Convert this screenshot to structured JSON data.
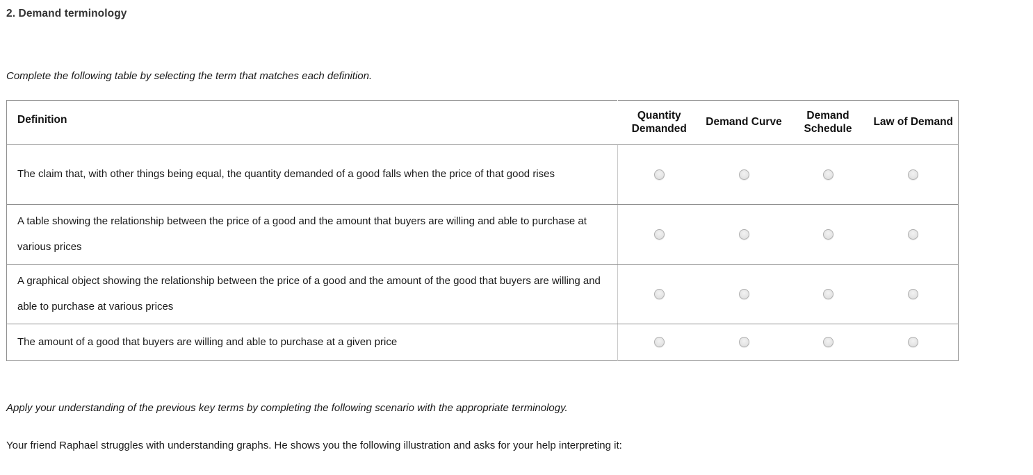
{
  "question": {
    "title": "2. Demand terminology",
    "instruction_table": "Complete the following table by selecting the term that matches each definition.",
    "instruction_scenario": "Apply your understanding of the previous key terms by completing the following scenario with the appropriate terminology.",
    "scenario_intro": "Your friend Raphael struggles with understanding graphs. He shows you the following illustration and asks for your help interpreting it:"
  },
  "table": {
    "headers": {
      "definition": "Definition",
      "options": [
        "Quantity Demanded",
        "Demand Curve",
        "Demand Schedule",
        "Law of Demand"
      ]
    },
    "rows": [
      {
        "definition": "The claim that, with other things being equal, the quantity demanded of a good falls when the price of that good rises",
        "selected": null
      },
      {
        "definition": "A table showing the relationship between the price of a good and the amount that buyers are willing and able to purchase at various prices",
        "selected": null
      },
      {
        "definition": "A graphical object showing the relationship between the price of a good and the amount of the good that buyers are willing and able to purchase at various prices",
        "selected": null
      },
      {
        "definition": "The amount of a good that buyers are willing and able to purchase at a given price",
        "selected": null
      }
    ]
  },
  "colors": {
    "border": "#909090",
    "text": "#1a1a1a",
    "title": "#333333",
    "radio_fill": "#e4e4e4",
    "radio_border": "#b0b0b0"
  }
}
